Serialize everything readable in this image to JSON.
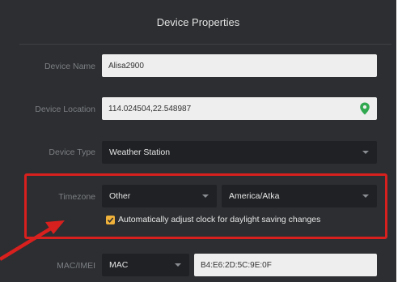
{
  "dialog": {
    "title": "Device Properties"
  },
  "fields": {
    "device_name": {
      "label": "Device Name",
      "value": "Alisa2900"
    },
    "device_location": {
      "label": "Device Location",
      "value": "114.024504,22.548987",
      "icon": "location-pin-icon"
    },
    "device_type": {
      "label": "Device Type",
      "value": "Weather Station"
    },
    "timezone": {
      "label": "Timezone",
      "region": "Other",
      "zone": "America/Atka"
    },
    "dst": {
      "label": "Automatically adjust clock for daylight saving changes",
      "checked": true
    },
    "mac_imei": {
      "label": "MAC/IMEI",
      "type": "MAC",
      "value": "B4:E6:2D:5C:9E:0F"
    }
  },
  "colors": {
    "panel_bg": "#2c2e31",
    "input_bg": "#eeeeee",
    "select_bg": "#1f2124",
    "accent": "#f0b23a",
    "highlight": "#d8201e",
    "pin": "#2fa84f"
  }
}
